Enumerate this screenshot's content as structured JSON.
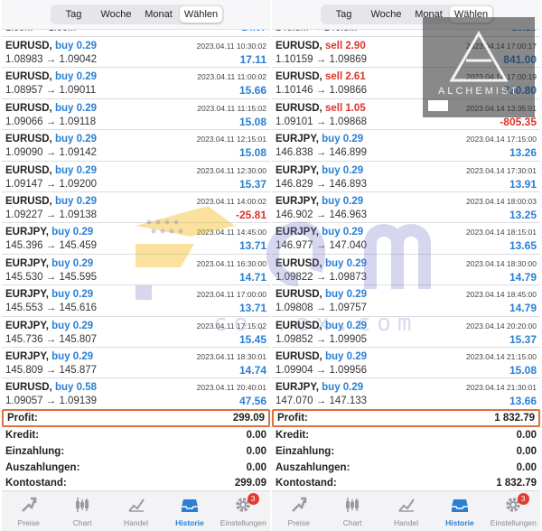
{
  "tabs": [
    "Tag",
    "Woche",
    "Monat",
    "Wählen"
  ],
  "active_tab": "Wählen",
  "left": {
    "cut_top": {
      "text": "1.09... → 1.09...",
      "pl": "14.07"
    },
    "trades": [
      {
        "symbol": "EURUSD,",
        "side": "buy 0.29",
        "dir": "buy",
        "time": "2023.04.11 10:30:02",
        "prices": "1.08983 → 1.09042",
        "pl": "17.11",
        "sign": "pos"
      },
      {
        "symbol": "EURUSD,",
        "side": "buy 0.29",
        "dir": "buy",
        "time": "2023.04.11 11:00:02",
        "prices": "1.08957 → 1.09011",
        "pl": "15.66",
        "sign": "pos"
      },
      {
        "symbol": "EURUSD,",
        "side": "buy 0.29",
        "dir": "buy",
        "time": "2023.04.11 11:15:02",
        "prices": "1.09066 → 1.09118",
        "pl": "15.08",
        "sign": "pos"
      },
      {
        "symbol": "EURUSD,",
        "side": "buy 0.29",
        "dir": "buy",
        "time": "2023.04.11 12:15:01",
        "prices": "1.09090 → 1.09142",
        "pl": "15.08",
        "sign": "pos"
      },
      {
        "symbol": "EURUSD,",
        "side": "buy 0.29",
        "dir": "buy",
        "time": "2023.04.11 12:30:00",
        "prices": "1.09147 → 1.09200",
        "pl": "15.37",
        "sign": "pos"
      },
      {
        "symbol": "EURUSD,",
        "side": "buy 0.29",
        "dir": "buy",
        "time": "2023.04.11 14:00:02",
        "prices": "1.09227 → 1.09138",
        "pl": "-25.81",
        "sign": "neg"
      },
      {
        "symbol": "EURJPY,",
        "side": "buy 0.29",
        "dir": "buy",
        "time": "2023.04.11 14:45:00",
        "prices": "145.396 → 145.459",
        "pl": "13.71",
        "sign": "pos"
      },
      {
        "symbol": "EURJPY,",
        "side": "buy 0.29",
        "dir": "buy",
        "time": "2023.04.11 16:30:00",
        "prices": "145.530 → 145.595",
        "pl": "14.71",
        "sign": "pos"
      },
      {
        "symbol": "EURJPY,",
        "side": "buy 0.29",
        "dir": "buy",
        "time": "2023.04.11 17:00:00",
        "prices": "145.553 → 145.616",
        "pl": "13.71",
        "sign": "pos"
      },
      {
        "symbol": "EURJPY,",
        "side": "buy 0.29",
        "dir": "buy",
        "time": "2023.04.11 17:15:02",
        "prices": "145.736 → 145.807",
        "pl": "15.45",
        "sign": "pos"
      },
      {
        "symbol": "EURJPY,",
        "side": "buy 0.29",
        "dir": "buy",
        "time": "2023.04.11 18:30:01",
        "prices": "145.809 → 145.877",
        "pl": "14.74",
        "sign": "pos"
      },
      {
        "symbol": "EURUSD,",
        "side": "buy 0.58",
        "dir": "buy",
        "time": "2023.04.11 20:40:01",
        "prices": "1.09057 → 1.09139",
        "pl": "47.56",
        "sign": "pos"
      }
    ],
    "summary": [
      {
        "label": "Profit:",
        "value": "299.09"
      },
      {
        "label": "Kredit:",
        "value": "0.00"
      },
      {
        "label": "Einzahlung:",
        "value": "0.00"
      },
      {
        "label": "Auszahlungen:",
        "value": "0.00"
      },
      {
        "label": "Kontostand:",
        "value": "299.09"
      }
    ]
  },
  "right": {
    "cut_top": {
      "text": "146.8... → 146.8...",
      "pl": "13.26"
    },
    "trades": [
      {
        "symbol": "EURUSD,",
        "side": "sell 2.90",
        "dir": "sell",
        "time": "2023.04.14 17:00:17",
        "prices": "1.10159 → 1.09869",
        "pl": "841.00",
        "sign": "pos"
      },
      {
        "symbol": "EURUSD,",
        "side": "sell 2.61",
        "dir": "sell",
        "time": "2023.04.14 17:00:19",
        "prices": "1.10146 → 1.09866",
        "pl": "730.80",
        "sign": "pos"
      },
      {
        "symbol": "EURUSD,",
        "side": "sell 1.05",
        "dir": "sell",
        "time": "2023.04.14 13:35:01",
        "prices": "1.09101 → 1.09868",
        "pl": "-805.35",
        "sign": "neg"
      },
      {
        "symbol": "EURJPY,",
        "side": "buy 0.29",
        "dir": "buy",
        "time": "2023.04.14 17:15:00",
        "prices": "146.838 → 146.899",
        "pl": "13.26",
        "sign": "pos"
      },
      {
        "symbol": "EURJPY,",
        "side": "buy 0.29",
        "dir": "buy",
        "time": "2023.04.14 17:30:01",
        "prices": "146.829 → 146.893",
        "pl": "13.91",
        "sign": "pos"
      },
      {
        "symbol": "EURJPY,",
        "side": "buy 0.29",
        "dir": "buy",
        "time": "2023.04.14 18:00:03",
        "prices": "146.902 → 146.963",
        "pl": "13.25",
        "sign": "pos"
      },
      {
        "symbol": "EURJPY,",
        "side": "buy 0.29",
        "dir": "buy",
        "time": "2023.04.14 18:15:01",
        "prices": "146.977 → 147.040",
        "pl": "13.65",
        "sign": "pos"
      },
      {
        "symbol": "EURUSD,",
        "side": "buy 0.29",
        "dir": "buy",
        "time": "2023.04.14 18:30:00",
        "prices": "1.09822 → 1.09873",
        "pl": "14.79",
        "sign": "pos"
      },
      {
        "symbol": "EURUSD,",
        "side": "buy 0.29",
        "dir": "buy",
        "time": "2023.04.14 18:45:00",
        "prices": "1.09808 → 1.09757",
        "pl": "14.79",
        "sign": "pos"
      },
      {
        "symbol": "EURUSD,",
        "side": "buy 0.29",
        "dir": "buy",
        "time": "2023.04.14 20:20:00",
        "prices": "1.09852 → 1.09905",
        "pl": "15.37",
        "sign": "pos"
      },
      {
        "symbol": "EURUSD,",
        "side": "buy 0.29",
        "dir": "buy",
        "time": "2023.04.14 21:15:00",
        "prices": "1.09904 → 1.09956",
        "pl": "15.08",
        "sign": "pos"
      },
      {
        "symbol": "EURJPY,",
        "side": "buy 0.29",
        "dir": "buy",
        "time": "2023.04.14 21:30:01",
        "prices": "147.070 → 147.133",
        "pl": "13.66",
        "sign": "pos"
      }
    ],
    "summary": [
      {
        "label": "Profit:",
        "value": "1 832.79"
      },
      {
        "label": "Kredit:",
        "value": "0.00"
      },
      {
        "label": "Einzahlung:",
        "value": "0.00"
      },
      {
        "label": "Auszahlungen:",
        "value": "0.00"
      },
      {
        "label": "Kontostand:",
        "value": "1 832.79"
      }
    ]
  },
  "nav": [
    {
      "label": "Preise",
      "icon": "quotes-icon"
    },
    {
      "label": "Chart",
      "icon": "candlestick-icon"
    },
    {
      "label": "Handel",
      "icon": "trade-chart-icon"
    },
    {
      "label": "Historie",
      "icon": "history-inbox-icon",
      "active": true
    },
    {
      "label": "Einstellungen",
      "icon": "gear-icon",
      "badge": "3"
    }
  ],
  "watermark": "co..ex.com",
  "overlay_brand": "ALCHEMIST",
  "colors": {
    "buy": "#2a7fd4",
    "sell": "#d9352b",
    "profit_border": "#e0703c",
    "nav_active": "#2a7fd4",
    "badge": "#e23b30"
  }
}
